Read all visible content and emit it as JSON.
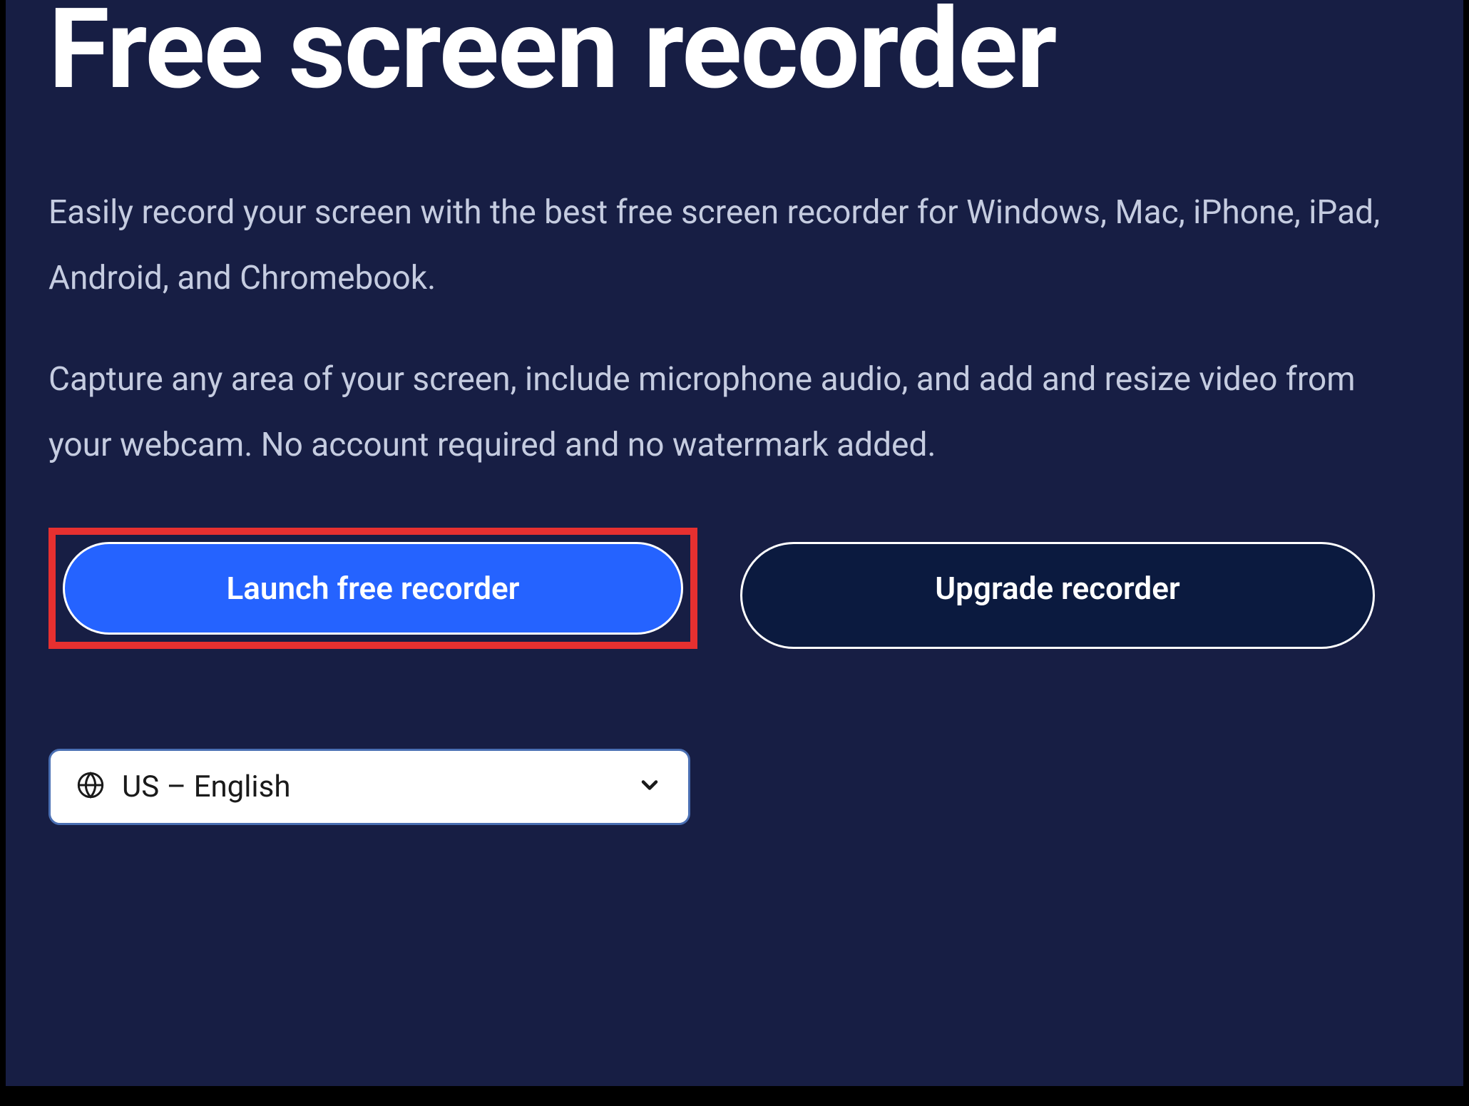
{
  "hero": {
    "title": "Free screen recorder",
    "paragraph1": "Easily record your screen with the best free screen recorder for Windows, Mac, iPhone, iPad, Android, and Chromebook.",
    "paragraph2": "Capture any area of your screen, include microphone audio, and add and resize video from your webcam. No account required and no watermark added."
  },
  "buttons": {
    "primary_label": "Launch free recorder",
    "secondary_label": "Upgrade recorder"
  },
  "language": {
    "selected": "US – English"
  },
  "colors": {
    "background": "#171e44",
    "primary_button": "#2563ff",
    "highlight": "#e63030"
  }
}
